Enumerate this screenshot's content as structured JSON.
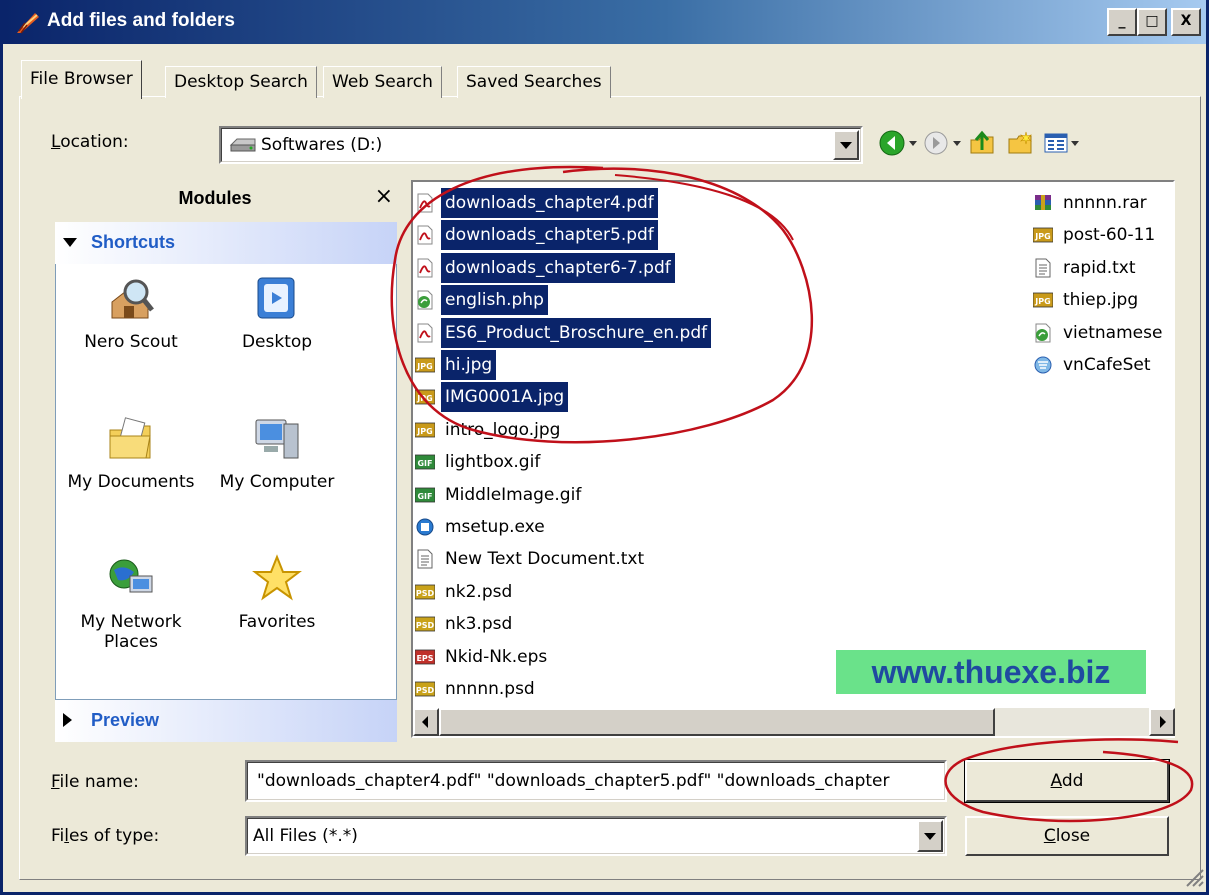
{
  "window": {
    "title": "Add files and folders",
    "buttons": [
      "_",
      "□",
      "X"
    ]
  },
  "tabs": [
    {
      "label": "File Browser",
      "active": true
    },
    {
      "label": "Desktop Search",
      "active": false
    },
    {
      "label": "Web Search",
      "active": false
    },
    {
      "label": "Saved Searches",
      "active": false
    }
  ],
  "location": {
    "label_pre": "",
    "label_underline": "L",
    "label_post": "ocation:",
    "value": "Softwares (D:)"
  },
  "toolbar": {
    "icons": [
      "back-icon",
      "forward-icon",
      "up-folder-icon",
      "new-folder-icon",
      "view-menu-icon"
    ]
  },
  "modules": {
    "title": "Modules",
    "close": "×",
    "shortcuts_header": "Shortcuts",
    "preview_header": "Preview",
    "shortcuts": [
      {
        "label": "Nero Scout",
        "icon": "nero-scout-icon"
      },
      {
        "label": "Desktop",
        "icon": "desktop-icon"
      },
      {
        "label": "My Documents",
        "icon": "my-documents-icon"
      },
      {
        "label": "My Computer",
        "icon": "my-computer-icon"
      },
      {
        "label": "My Network Places",
        "icon": "network-places-icon"
      },
      {
        "label": "Favorites",
        "icon": "favorites-icon"
      }
    ]
  },
  "files": {
    "column1": [
      {
        "name": "downloads_chapter4.pdf",
        "type": "pdf",
        "selected": true
      },
      {
        "name": "downloads_chapter5.pdf",
        "type": "pdf",
        "selected": true
      },
      {
        "name": "downloads_chapter6-7.pdf",
        "type": "pdf",
        "selected": true
      },
      {
        "name": "english.php",
        "type": "php",
        "selected": true
      },
      {
        "name": "ES6_Product_Broschure_en.pdf",
        "type": "pdf",
        "selected": true
      },
      {
        "name": "hi.jpg",
        "type": "jpg",
        "selected": true
      },
      {
        "name": "IMG0001A.jpg",
        "type": "jpg",
        "selected": true
      },
      {
        "name": "intro_logo.jpg",
        "type": "jpg",
        "selected": false
      },
      {
        "name": "lightbox.gif",
        "type": "gif",
        "selected": false
      },
      {
        "name": "MiddleImage.gif",
        "type": "gif",
        "selected": false
      },
      {
        "name": "msetup.exe",
        "type": "exe",
        "selected": false
      },
      {
        "name": "New Text Document.txt",
        "type": "txt",
        "selected": false
      },
      {
        "name": "nk2.psd",
        "type": "psd",
        "selected": false
      },
      {
        "name": "nk3.psd",
        "type": "psd",
        "selected": false
      },
      {
        "name": "Nkid-Nk.eps",
        "type": "eps",
        "selected": false
      },
      {
        "name": "nnnnn.psd",
        "type": "psd",
        "selected": false
      }
    ],
    "column2": [
      {
        "name": "nnnnn.rar",
        "type": "rar",
        "selected": false
      },
      {
        "name": "post-60-11",
        "type": "jpg",
        "selected": false
      },
      {
        "name": "rapid.txt",
        "type": "txt",
        "selected": false
      },
      {
        "name": "thiep.jpg",
        "type": "jpg",
        "selected": false
      },
      {
        "name": "vietnamese",
        "type": "php",
        "selected": false
      },
      {
        "name": "vnCafeSet",
        "type": "exe2",
        "selected": false
      }
    ]
  },
  "watermark": "www.thuexe.biz",
  "filename": {
    "label_pre": "",
    "label_underline": "F",
    "label_post": "ile name:",
    "value": "\"downloads_chapter4.pdf\" \"downloads_chapter5.pdf\" \"downloads_chapter"
  },
  "filetype": {
    "label_pre": "Fi",
    "label_underline": "l",
    "label_post": "es of type:",
    "value": "All Files (*.*)"
  },
  "buttons": {
    "add_underline": "A",
    "add_rest": "dd",
    "close_underline": "C",
    "close_rest": "lose"
  },
  "colors": {
    "selection": "#0a246a",
    "annotation": "#c0101a",
    "watermark_bg": "#6ae28a"
  }
}
